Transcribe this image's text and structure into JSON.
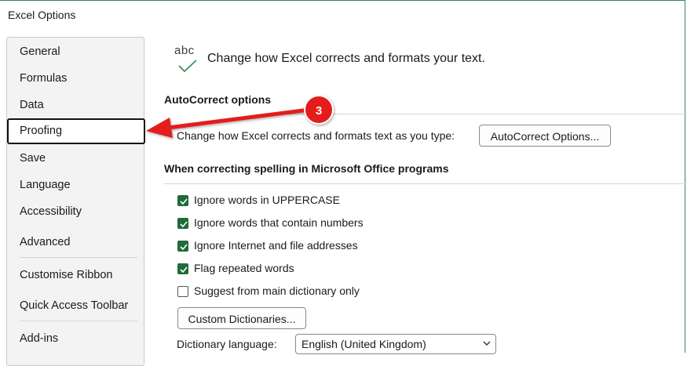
{
  "window": {
    "title": "Excel Options"
  },
  "sidebar": {
    "items": [
      {
        "label": "General"
      },
      {
        "label": "Formulas"
      },
      {
        "label": "Data"
      },
      {
        "label": "Proofing",
        "selected": true
      },
      {
        "label": "Save"
      },
      {
        "label": "Language"
      },
      {
        "label": "Accessibility"
      },
      {
        "label": "Advanced"
      },
      {
        "label": "Customise Ribbon"
      },
      {
        "label": "Quick Access Toolbar"
      },
      {
        "label": "Add-ins"
      }
    ]
  },
  "header": {
    "icon_text": "abc",
    "text": "Change how Excel corrects and formats your text."
  },
  "autocorrect": {
    "heading": "AutoCorrect options",
    "description": "Change how Excel corrects and formats text as you type:",
    "button_label": "AutoCorrect Options..."
  },
  "spelling": {
    "heading": "When correcting spelling in Microsoft Office programs",
    "options": [
      {
        "label": "Ignore words in UPPERCASE",
        "checked": true
      },
      {
        "label": "Ignore words that contain numbers",
        "checked": true
      },
      {
        "label": "Ignore Internet and file addresses",
        "checked": true
      },
      {
        "label": "Flag repeated words",
        "checked": true
      },
      {
        "label": "Suggest from main dictionary only",
        "checked": false
      }
    ],
    "custom_dictionaries_label": "Custom Dictionaries...",
    "dictionary_language_label": "Dictionary language:",
    "dictionary_language_value": "English (United Kingdom)"
  },
  "annotation": {
    "step_number": "3",
    "color": "#e51d1d"
  },
  "colors": {
    "accent_check": "#1f6b3a",
    "icon_check": "#2e8b57"
  }
}
